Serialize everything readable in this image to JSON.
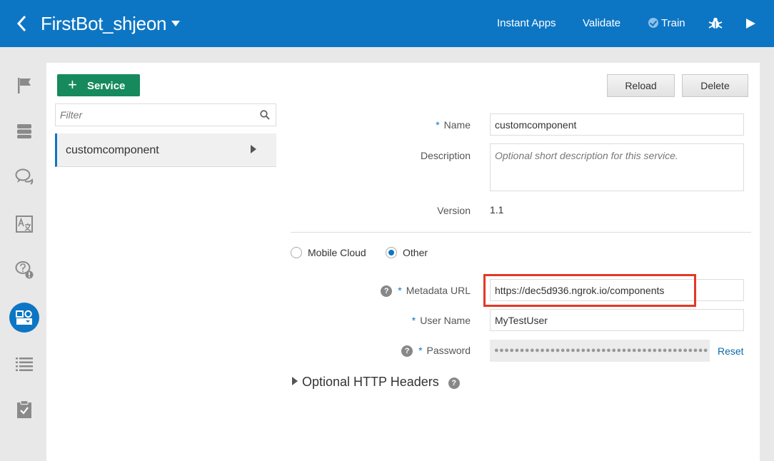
{
  "header": {
    "title": "FirstBot_shjeon",
    "links": {
      "instant_apps": "Instant Apps",
      "validate": "Validate",
      "train": "Train"
    }
  },
  "rail": {
    "icons": [
      "intents-flag-icon",
      "entities-database-icon",
      "flows-chat-icon",
      "resource-bundles-icon",
      "qna-icon",
      "components-icon",
      "logs-list-icon",
      "tests-clipboard-icon"
    ],
    "active": "components-icon"
  },
  "sidebar": {
    "add_service_label": "Service",
    "filter_placeholder": "Filter",
    "items": [
      {
        "label": "customcomponent"
      }
    ]
  },
  "toolbar": {
    "reload_label": "Reload",
    "delete_label": "Delete"
  },
  "form": {
    "name_label": "Name",
    "name_value": "customcomponent",
    "description_label": "Description",
    "description_placeholder": "Optional short description for this service.",
    "version_label": "Version",
    "version_value": "1.1",
    "radio_mobile_cloud": "Mobile Cloud",
    "radio_other": "Other",
    "selected_radio": "Other",
    "metadata_url_label": "Metadata URL",
    "metadata_url_value": "https://dec5d936.ngrok.io/components",
    "user_name_label": "User Name",
    "user_name_value": "MyTestUser",
    "password_label": "Password",
    "password_mask": "●●●●●●●●●●●●●●●●●●●●●●●●●●●●●●●●●●●●●●●●●●",
    "reset_label": "Reset",
    "required_mark": "*",
    "help_mark": "?",
    "optional_headers_label": "Optional HTTP Headers"
  },
  "colors": {
    "header_blue": "#0d76c4",
    "service_green": "#168a5c",
    "highlight_red": "#e53727",
    "link_blue": "#0d6aa8"
  }
}
